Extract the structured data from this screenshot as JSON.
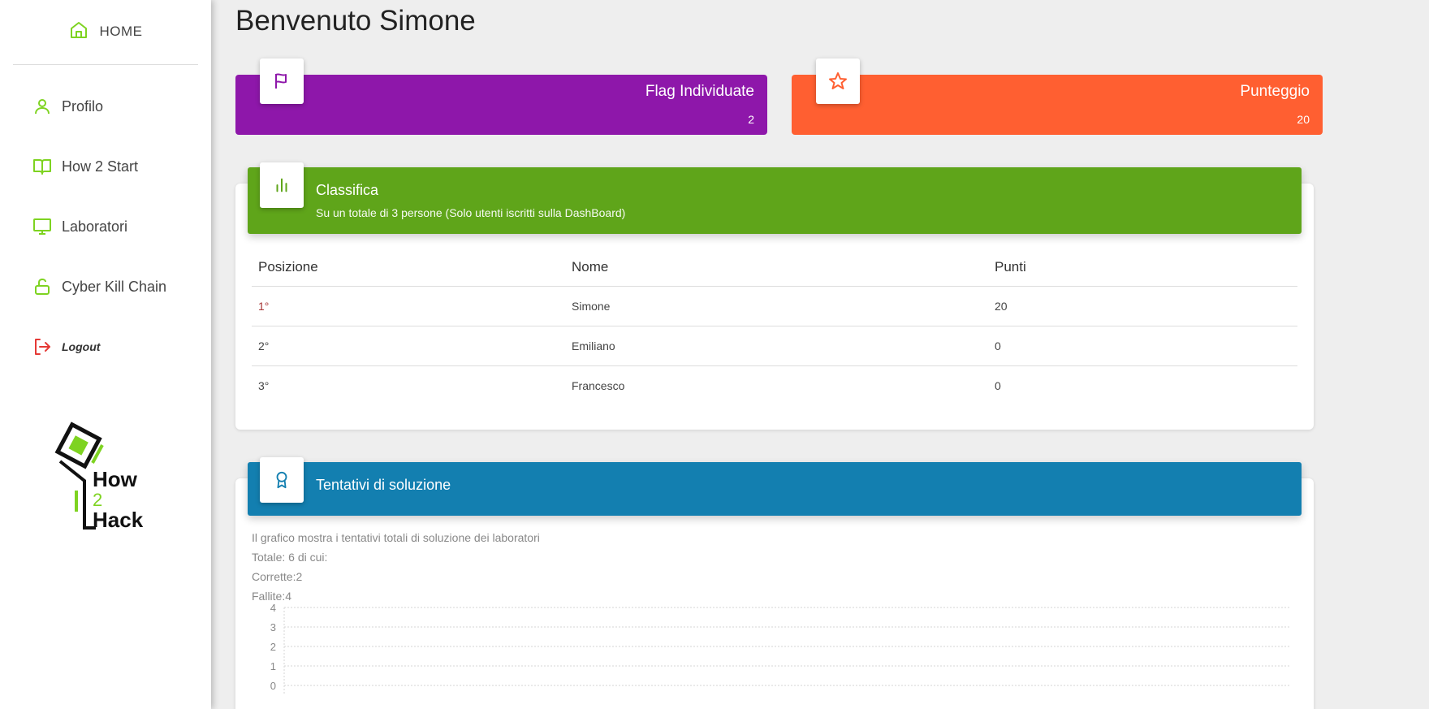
{
  "sidebar": {
    "home_label": "HOME",
    "items": [
      {
        "label": "Profilo",
        "icon": "user-icon"
      },
      {
        "label": "How 2 Start",
        "icon": "book-icon"
      },
      {
        "label": "Laboratori",
        "icon": "monitor-icon"
      },
      {
        "label": "Cyber Kill Chain",
        "icon": "unlock-icon"
      },
      {
        "label": "Logout",
        "icon": "logout-icon"
      }
    ],
    "logo": {
      "line1": "How",
      "line2": "2",
      "line3": "Hack"
    }
  },
  "colors": {
    "accent_green": "#7ed321",
    "purple": "#8e17aa",
    "orange": "#ff5f31",
    "green_header": "#5fa51a",
    "blue_header": "#137fb0",
    "logout_red": "#e53935"
  },
  "main": {
    "title": "Benvenuto Simone",
    "stats": [
      {
        "title": "Flag Individuate",
        "value": "2",
        "icon": "flag-icon"
      },
      {
        "title": "Punteggio",
        "value": "20",
        "icon": "star-icon"
      }
    ],
    "leaderboard": {
      "title": "Classifica",
      "subtitle": "Su un totale di 3 persone (Solo utenti iscritti sulla DashBoard)",
      "icon": "bar-chart-icon",
      "columns": [
        "Posizione",
        "Nome",
        "Punti"
      ],
      "rows": [
        [
          "1°",
          "Simone",
          "20"
        ],
        [
          "2°",
          "Emiliano",
          "0"
        ],
        [
          "3°",
          "Francesco",
          "0"
        ]
      ]
    },
    "attempts": {
      "title": "Tentativi di soluzione",
      "icon": "award-icon",
      "description": "Il grafico mostra i tentativi totali di soluzione dei laboratori",
      "total": "Totale: 6 di cui:",
      "correct": "Corrette:2",
      "failed": "Fallite:4"
    }
  },
  "chart_data": {
    "type": "bar",
    "ylim": [
      0,
      4
    ],
    "yticks": [
      "4",
      "3",
      "2",
      "1",
      "0"
    ],
    "grid": true
  }
}
